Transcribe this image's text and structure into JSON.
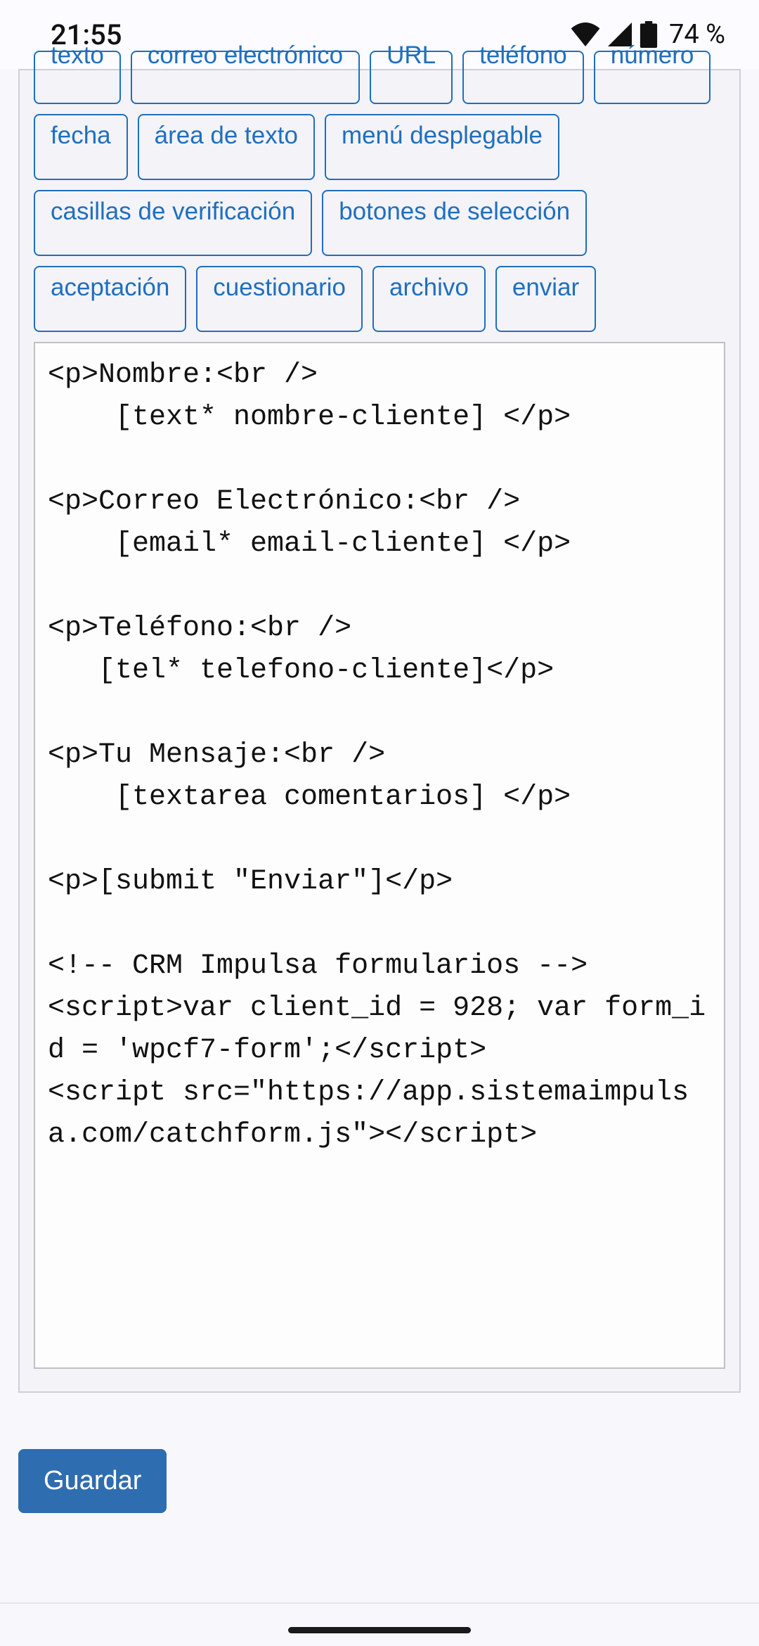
{
  "status": {
    "time": "21:55",
    "battery": "74 %"
  },
  "tags": {
    "row1": {
      "texto": "texto",
      "correo": "correo electrónico",
      "url": "URL",
      "telefono": "teléfono",
      "numero": "número"
    },
    "row2": {
      "fecha": "fecha",
      "area": "área de texto",
      "menu": "menú desplegable"
    },
    "row3": {
      "casillas": "casillas de verificación",
      "botones": "botones de selección"
    },
    "row4": {
      "aceptacion": "aceptación",
      "cuestionario": "cuestionario",
      "archivo": "archivo",
      "enviar": "enviar"
    }
  },
  "form_code": "<p>Nombre:<br />\n    [text* nombre-cliente] </p>\n\n<p>Correo Electrónico:<br />\n    [email* email-cliente] </p>\n\n<p>Teléfono:<br />\n   [tel* telefono-cliente]</p>\n\n<p>Tu Mensaje:<br />\n    [textarea comentarios] </p>\n\n<p>[submit \"Enviar\"]</p>\n\n<!-- CRM Impulsa formularios -->\n<script>var client_id = 928; var form_id = 'wpcf7-form';</script>\n<script src=\"https://app.sistemaimpulsa.com/catchform.js\"></script>",
  "buttons": {
    "save": "Guardar"
  }
}
